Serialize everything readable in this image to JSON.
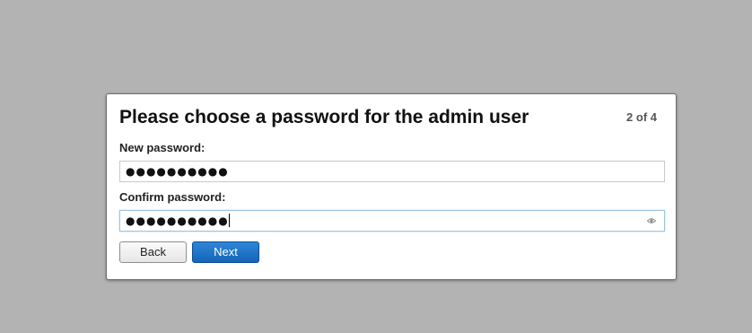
{
  "dialog": {
    "title": "Please choose a password for the admin user",
    "step": "2 of 4"
  },
  "fields": {
    "new_password": {
      "label": "New password:",
      "value": "●●●●●●●●●●"
    },
    "confirm_password": {
      "label": "Confirm password:",
      "value": "●●●●●●●●●●"
    }
  },
  "buttons": {
    "back": "Back",
    "next": "Next"
  },
  "icons": {
    "reveal": "eye-icon"
  },
  "colors": {
    "background": "#b3b3b3",
    "primary_button": "#1a6fc4",
    "focus_border": "#9cc4e0"
  }
}
